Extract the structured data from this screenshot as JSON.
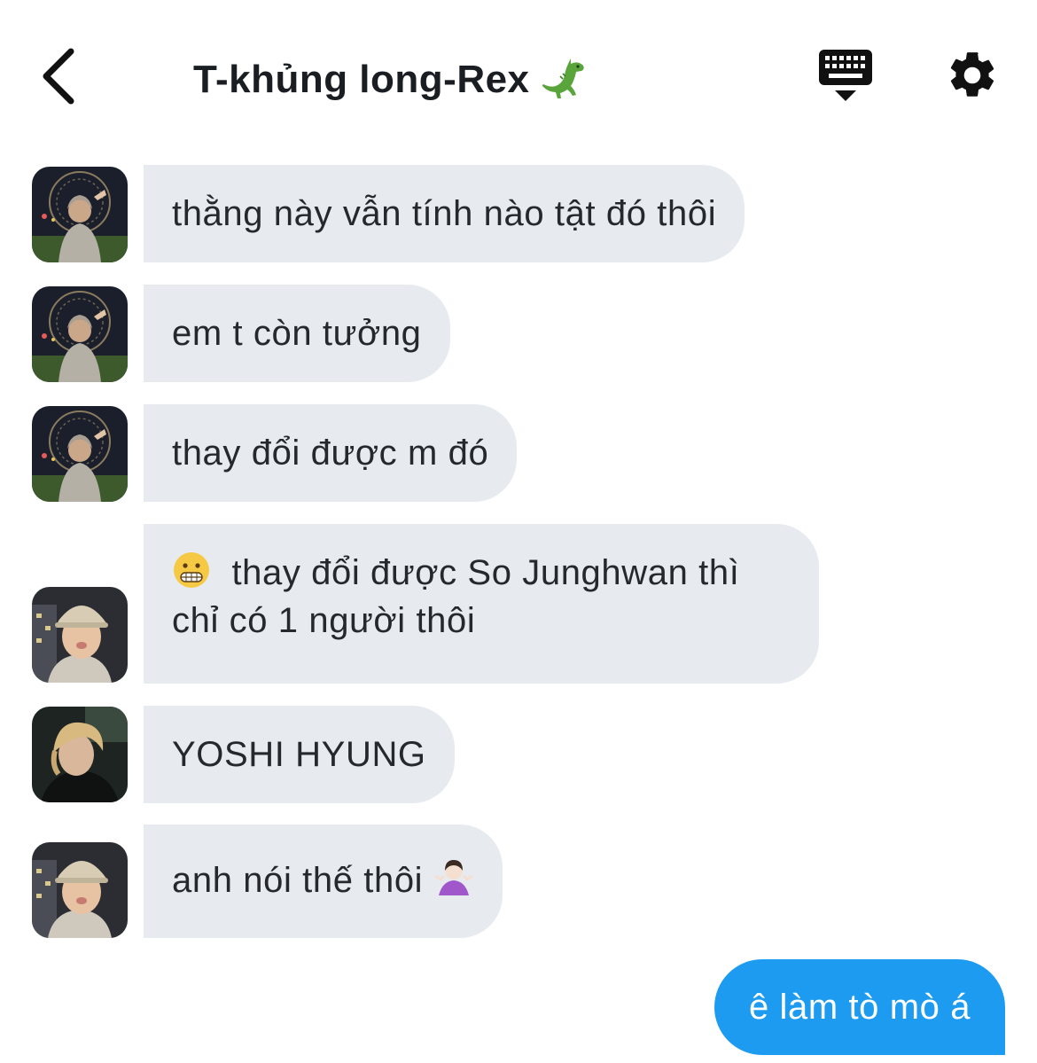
{
  "header": {
    "title": "T-khủng long-Rex",
    "title_emoji": "dinosaur-emoji",
    "back_icon": "chevron-left-icon",
    "keyboard_icon": "keyboard-icon",
    "settings_icon": "gear-icon"
  },
  "messages": [
    {
      "avatar": "avatar-ferris-wheel",
      "text": "thằng này vẫn tính nào tật đó thôi"
    },
    {
      "avatar": "avatar-ferris-wheel",
      "text": "em t còn tưởng"
    },
    {
      "avatar": "avatar-ferris-wheel",
      "text": "thay đổi được m đó"
    },
    {
      "avatar": "avatar-cap",
      "emoji": "grimacing-emoji",
      "text": "thay đổi được So Junghwan thì chỉ có 1 người thôi"
    },
    {
      "avatar": "avatar-blond",
      "text": "YOSHI HYUNG"
    },
    {
      "avatar": "avatar-cap",
      "text": "anh nói thế thôi",
      "emoji": "person-shrugging-emoji"
    }
  ],
  "sent_message": {
    "text": "ê làm tò mò á"
  },
  "colors": {
    "bubble_in": "#e7ebf0",
    "bubble_out": "#1d9bf0",
    "text": "#25282c"
  }
}
